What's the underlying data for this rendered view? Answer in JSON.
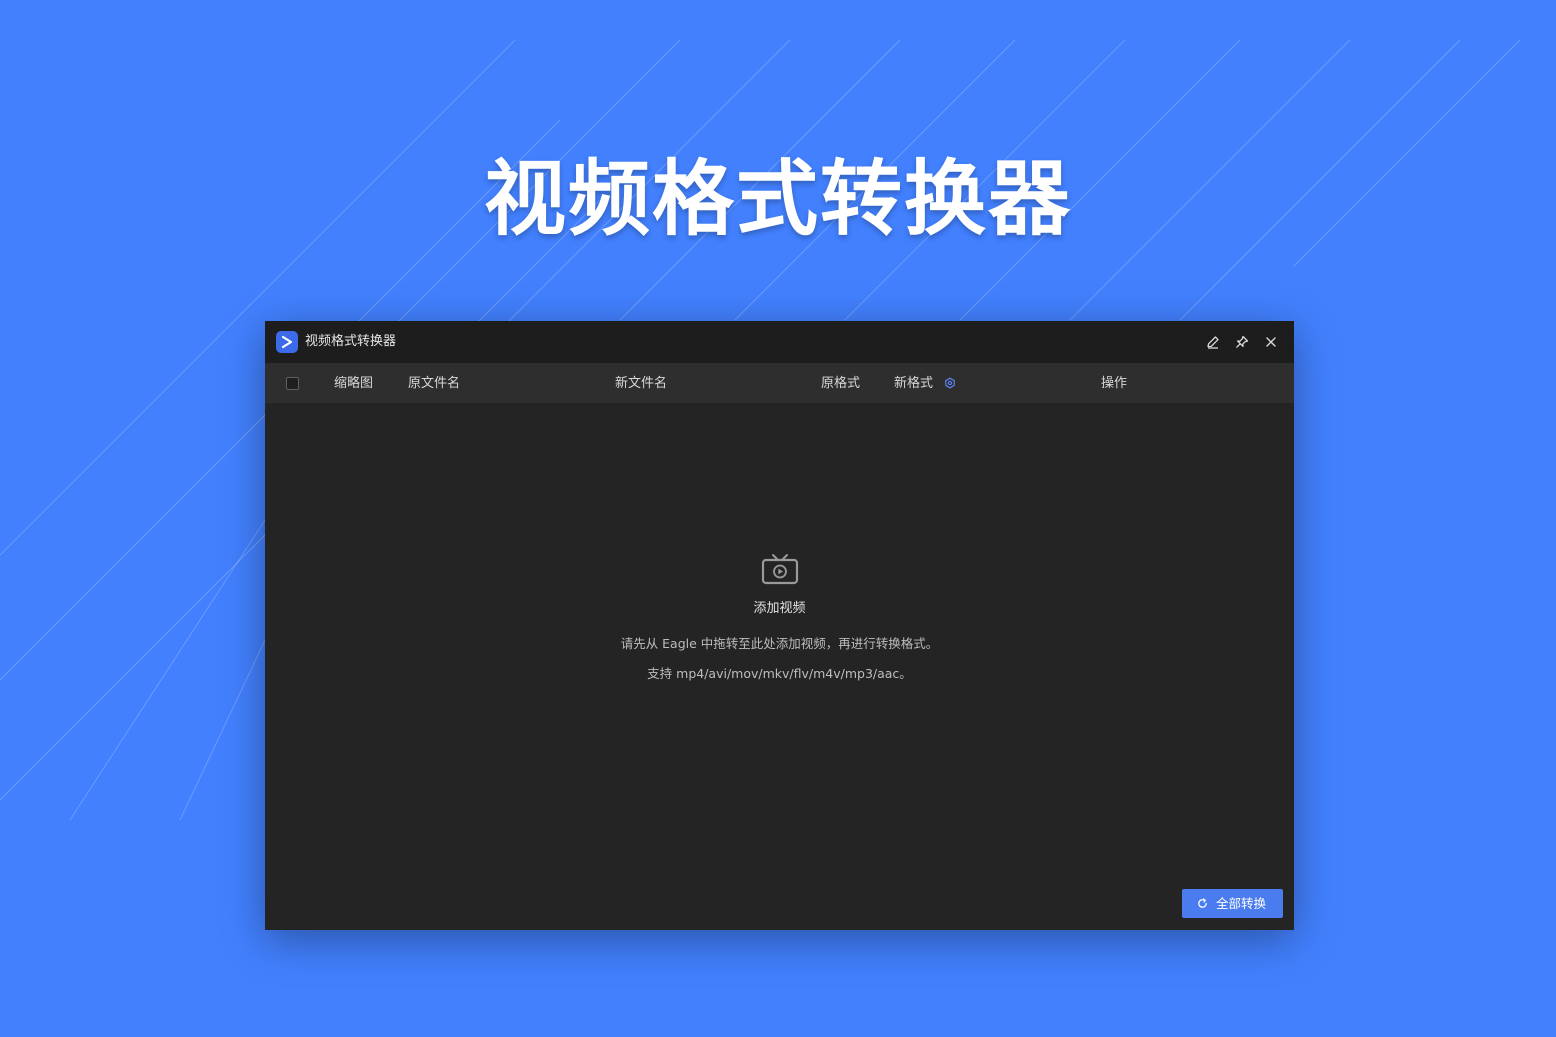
{
  "hero": {
    "title": "视频格式转换器"
  },
  "window": {
    "app_title": "视频格式转换器",
    "logo_glyph": ">",
    "controls": {
      "edit_icon": "pencil-icon",
      "pin_icon": "pin-icon",
      "close_icon": "close-icon"
    }
  },
  "table": {
    "columns": {
      "thumbnail": "缩略图",
      "original_name": "原文件名",
      "new_name": "新文件名",
      "original_format": "原格式",
      "new_format": "新格式",
      "actions": "操作"
    }
  },
  "empty_state": {
    "icon": "tv-play-icon",
    "title": "添加视频",
    "description": "请先从 Eagle 中拖转至此处添加视频，再进行转换格式。",
    "formats": "支持 mp4/avi/mov/mkv/flv/m4v/mp3/aac。"
  },
  "footer": {
    "convert_all_label": "全部转换"
  },
  "colors": {
    "background": "#4280fe",
    "window_bg": "#242424",
    "titlebar_bg": "#1d1d1d",
    "header_bg": "#2e2e2e",
    "accent": "#4a7cf0"
  }
}
